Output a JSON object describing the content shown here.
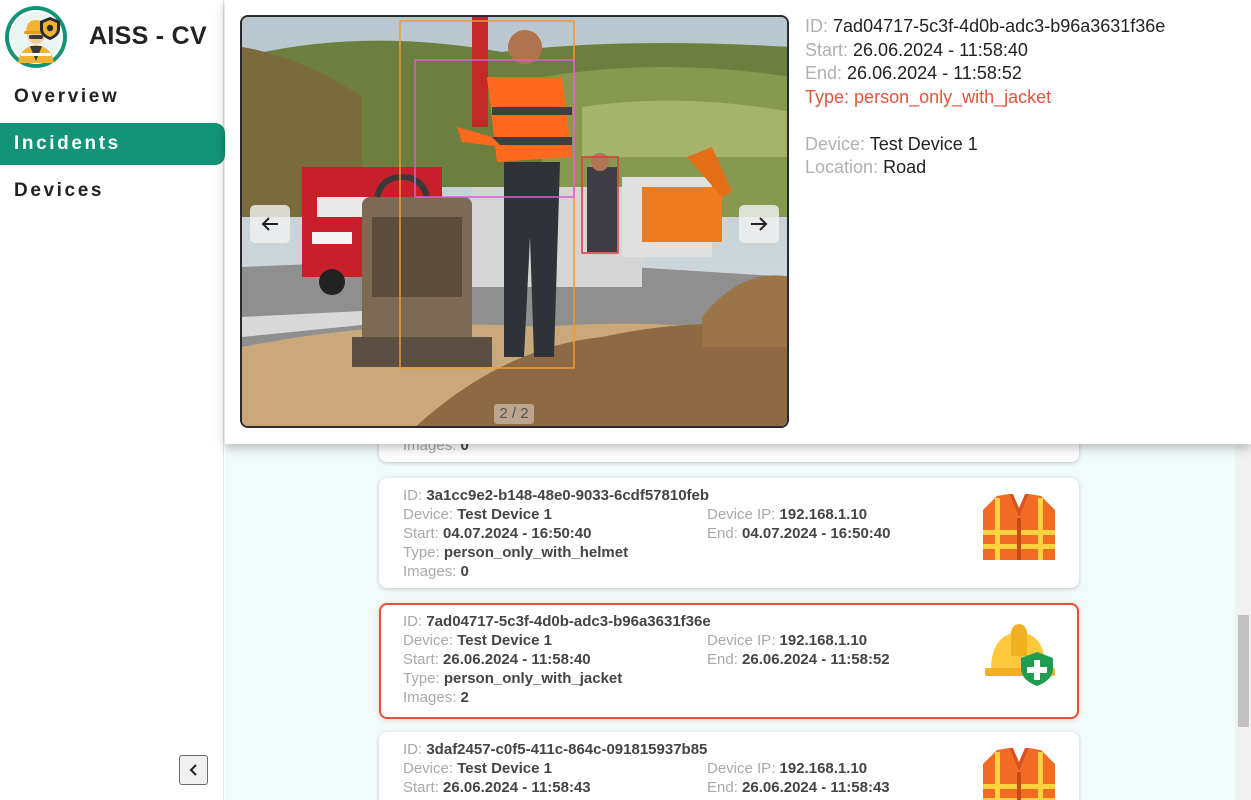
{
  "app": {
    "title": "AISS - CV"
  },
  "sidebar": {
    "items": [
      {
        "label": "Overview"
      },
      {
        "label": "Incidents"
      },
      {
        "label": "Devices"
      }
    ],
    "collapse_icon": "chevron-left-icon"
  },
  "detail": {
    "counter": "2 / 2",
    "labels": {
      "id": "ID:",
      "start": "Start:",
      "end": "End:",
      "type": "Type:",
      "device": "Device:",
      "location": "Location:"
    },
    "id": "7ad04717-5c3f-4d0b-adc3-b96a3631f36e",
    "start": "26.06.2024 - 11:58:40",
    "end": "26.06.2024 - 11:58:52",
    "type": "person_only_with_jacket",
    "device": "Test Device 1",
    "location": "Road",
    "type_color": "#e0543a"
  },
  "card_labels": {
    "id": "ID:",
    "device": "Device:",
    "device_ip": "Device IP:",
    "start": "Start:",
    "end": "End:",
    "type": "Type:",
    "images": "Images:"
  },
  "incidents": [
    {
      "images": "0"
    },
    {
      "id": "3a1cc9e2-b148-48e0-9033-6cdf57810feb",
      "device": "Test Device 1",
      "device_ip": "192.168.1.10",
      "start": "04.07.2024 - 16:50:40",
      "end": "04.07.2024 - 16:50:40",
      "type": "person_only_with_helmet",
      "images": "0",
      "icon": "safety-vest-icon"
    },
    {
      "id": "7ad04717-5c3f-4d0b-adc3-b96a3631f36e",
      "device": "Test Device 1",
      "device_ip": "192.168.1.10",
      "start": "26.06.2024 - 11:58:40",
      "end": "26.06.2024 - 11:58:52",
      "type": "person_only_with_jacket",
      "images": "2",
      "icon": "hard-hat-icon"
    },
    {
      "id": "3daf2457-c0f5-411c-864c-091815937b85",
      "device": "Test Device 1",
      "device_ip": "192.168.1.10",
      "start": "26.06.2024 - 11:58:43",
      "end": "26.06.2024 - 11:58:43",
      "icon": "safety-vest-icon"
    }
  ],
  "colors": {
    "accent": "#139478",
    "selected_border": "#e0543a",
    "main_bg": "#f2fbfb"
  }
}
